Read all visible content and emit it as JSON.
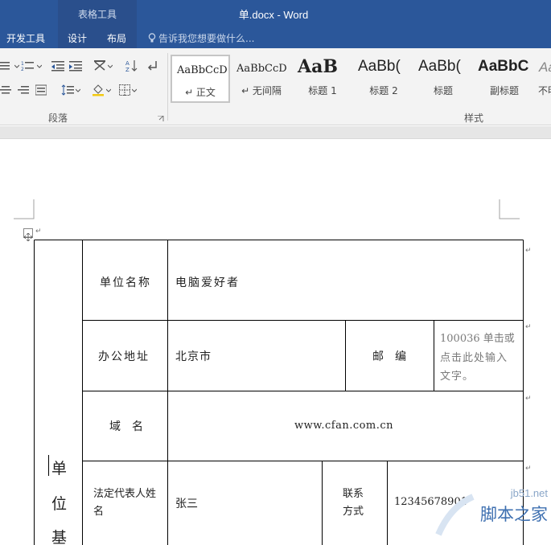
{
  "titlebar": {
    "context_tab_group": "表格工具",
    "document_title": "单.docx - Word"
  },
  "tabs": [
    {
      "label": "开发工具"
    },
    {
      "label": "设计"
    },
    {
      "label": "布局"
    }
  ],
  "tell_me": "告诉我您想要做什么...",
  "ribbon": {
    "paragraph_group_label": "段落",
    "styles_group_label": "样式",
    "styles": [
      {
        "sample": "AaBbCcD",
        "name": "↵ 正文",
        "selected": true
      },
      {
        "sample": "AaBbCcD",
        "name": "↵ 无间隔"
      },
      {
        "sample": "AaB",
        "name": "标题 1"
      },
      {
        "sample": "AaBb(",
        "name": "标题 2"
      },
      {
        "sample": "AaBb(",
        "name": "标题"
      },
      {
        "sample": "AaBbC",
        "name": "副标题"
      },
      {
        "sample": "Aa",
        "name": "不明"
      }
    ]
  },
  "table": {
    "side_label_chars": [
      "单",
      "位",
      "基"
    ],
    "rows": [
      {
        "label": "单位名称",
        "value": "电脑爱好者"
      },
      {
        "label": "办公地址",
        "value": "北京市",
        "label2": "邮　编",
        "value2": "100036 单击或点击此处输入文字。"
      },
      {
        "label": "域　名",
        "value": "www.cfan.com.cn"
      },
      {
        "label": "法定代表人姓　　名",
        "value": "张三",
        "label2": "联系方式",
        "value2": "12345678901"
      }
    ],
    "address_placeholder_lines": [
      "100036 单击或",
      "点击此处输入",
      "文字。"
    ]
  },
  "watermark": {
    "site": "jb51.net",
    "name": "脚本之家"
  },
  "colors": {
    "word_blue": "#2b579a",
    "ribbon_bg": "#f3f3f3"
  }
}
